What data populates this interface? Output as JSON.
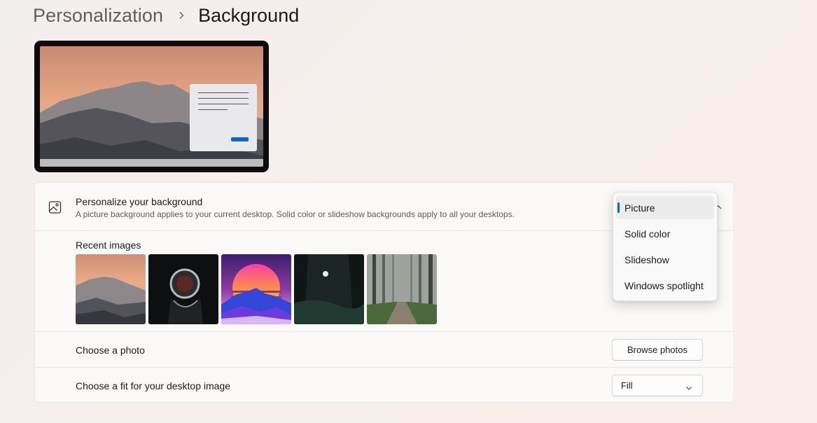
{
  "breadcrumb": {
    "parent": "Personalization",
    "separator_icon": "chevron-right-icon",
    "current": "Background"
  },
  "preview": {
    "description_icon": "mountain-wallpaper-preview"
  },
  "personalize": {
    "icon": "image-icon",
    "title": "Personalize your background",
    "description": "A picture background applies to your current desktop. Solid color or slideshow backgrounds apply to all your desktops.",
    "selected": "Picture"
  },
  "dropdown": {
    "options": [
      "Picture",
      "Solid color",
      "Slideshow",
      "Windows spotlight"
    ],
    "selected_index": 0
  },
  "recent_images": {
    "label": "Recent images",
    "items": [
      "mountain-sunset",
      "astronaut",
      "synthwave-sun",
      "dark-forest-moon",
      "foggy-forest-road"
    ]
  },
  "choose_photo": {
    "label": "Choose a photo",
    "button": "Browse photos"
  },
  "choose_fit": {
    "label": "Choose a fit for your desktop image",
    "value": "Fill"
  },
  "colors": {
    "accent": "#0d67c0"
  }
}
